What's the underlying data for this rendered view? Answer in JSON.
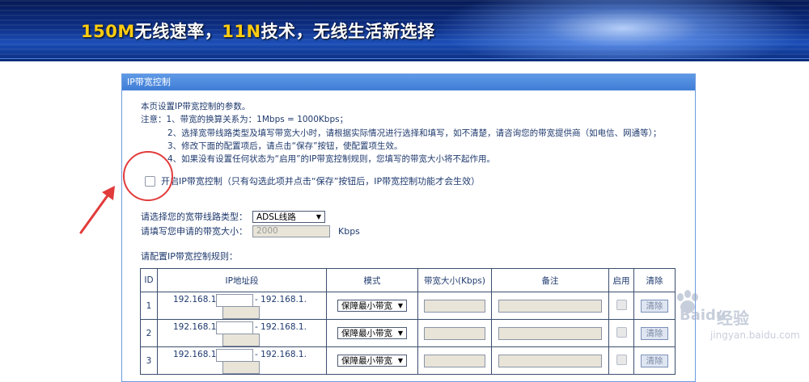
{
  "banner": {
    "slogan_part1": "150M",
    "slogan_part2": "无线速率，",
    "slogan_part3": "11N",
    "slogan_part4": "技术，无线生活新选择"
  },
  "panel": {
    "title": "IP带宽控制"
  },
  "notes": {
    "intro": "本页设置IP带宽控制的参数。",
    "line1": "注意：1、带宽的换算关系为：1Mbps = 1000Kbps；",
    "line2": "2、选择宽带线路类型及填写带宽大小时，请根据实际情况进行选择和填写，如不清楚，请咨询您的带宽提供商（如电信、网通等）；",
    "line3": "3、修改下面的配置项后，请点击“保存”按钮，使配置项生效。",
    "line4": "4、如果没有设置任何状态为“启用”的IP带宽控制规则，您填写的带宽大小将不起作用。"
  },
  "enable_control": {
    "label": "开启IP带宽控制（只有勾选此项并点击“保存”按钮后，IP带宽控制功能才会生效）",
    "checked": false
  },
  "line_type": {
    "label": "请选择您的宽带线路类型：",
    "value": "ADSL线路"
  },
  "bandwidth": {
    "label": "请填写您申请的带宽大小：",
    "value": "2000",
    "unit": "Kbps"
  },
  "rules": {
    "label": "请配置IP带宽控制规则：",
    "headers": [
      "ID",
      "IP地址段",
      "模式",
      "带宽大小(Kbps)",
      "备注",
      "启用",
      "清除"
    ],
    "rows": [
      {
        "id": "1",
        "ip_prefix": "192.168.1.",
        "ip_prefix2": "- 192.168.1.",
        "mode": "保障最小带宽",
        "clear": "清除"
      },
      {
        "id": "2",
        "ip_prefix": "192.168.1.",
        "ip_prefix2": "- 192.168.1.",
        "mode": "保障最小带宽",
        "clear": "清除"
      },
      {
        "id": "3",
        "ip_prefix": "192.168.1.",
        "ip_prefix2": "- 192.168.1.",
        "mode": "保障最小带宽",
        "clear": "清除"
      }
    ]
  },
  "watermark": {
    "brand": "Baidu",
    "cn": "经验",
    "url": "jingyan.baidu.com"
  },
  "colors": {
    "annotation": "#e23b3b",
    "panel_title": "#4a88dd"
  }
}
